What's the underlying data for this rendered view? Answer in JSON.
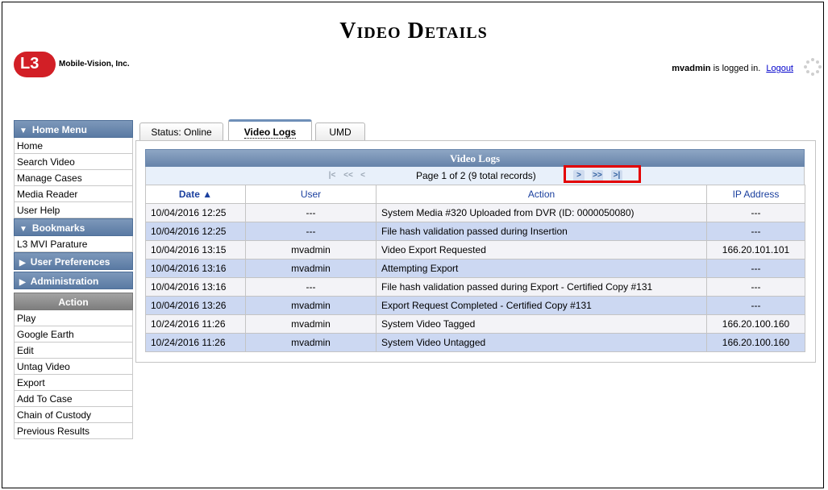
{
  "header": {
    "title": "Video Details",
    "logo_mark": "L3",
    "logo_text": "Mobile-Vision, Inc.",
    "user": "mvadmin",
    "logged_in_text": " is logged in.",
    "logout": "Logout",
    "spinner_icon": "loading-spinner-icon"
  },
  "sidebar": {
    "home_menu": {
      "label": "Home Menu",
      "items": [
        "Home",
        "Search Video",
        "Manage Cases",
        "Media Reader",
        "User Help"
      ]
    },
    "bookmarks": {
      "label": "Bookmarks",
      "items": [
        "L3 MVI Parature"
      ]
    },
    "user_preferences": "User Preferences",
    "administration": "Administration",
    "action": {
      "label": "Action",
      "items": [
        "Play",
        "Google Earth",
        "Edit",
        "Untag Video",
        "Export",
        "Add To Case",
        "Chain of Custody",
        "Previous Results"
      ]
    }
  },
  "tabs": [
    {
      "label": "Status: Online"
    },
    {
      "label": "Video Logs"
    },
    {
      "label": "UMD"
    }
  ],
  "grid": {
    "title": "Video Logs",
    "pager_text": "Page 1 of 2 (9 total records)",
    "pager_icons": [
      "first-page-icon",
      "prev-fast-icon",
      "prev-page-icon",
      "next-page-icon",
      "next-fast-icon",
      "last-page-icon"
    ],
    "columns": [
      "Date ▲",
      "User",
      "Action",
      "IP Address"
    ],
    "rows": [
      [
        "10/04/2016 12:25",
        "---",
        "System Media #320 Uploaded from DVR (ID: 0000050080)",
        "---"
      ],
      [
        "10/04/2016 12:25",
        "---",
        "File hash validation passed during Insertion",
        "---"
      ],
      [
        "10/04/2016 13:15",
        "mvadmin",
        "Video Export Requested",
        "166.20.101.101"
      ],
      [
        "10/04/2016 13:16",
        "mvadmin",
        "Attempting Export",
        "---"
      ],
      [
        "10/04/2016 13:16",
        "---",
        "File hash validation passed during Export - Certified Copy #131",
        "---"
      ],
      [
        "10/04/2016 13:26",
        "mvadmin",
        "Export Request Completed - Certified Copy #131",
        "---"
      ],
      [
        "10/24/2016 11:26",
        "mvadmin",
        "System Video Tagged",
        "166.20.100.160"
      ],
      [
        "10/24/2016 11:26",
        "mvadmin",
        "System Video Untagged",
        "166.20.100.160"
      ]
    ]
  },
  "colors": {
    "menu_header": "#6784aa",
    "row_alt": "#ccd8f2",
    "highlight": "#e30000",
    "link": "#0000cc"
  }
}
